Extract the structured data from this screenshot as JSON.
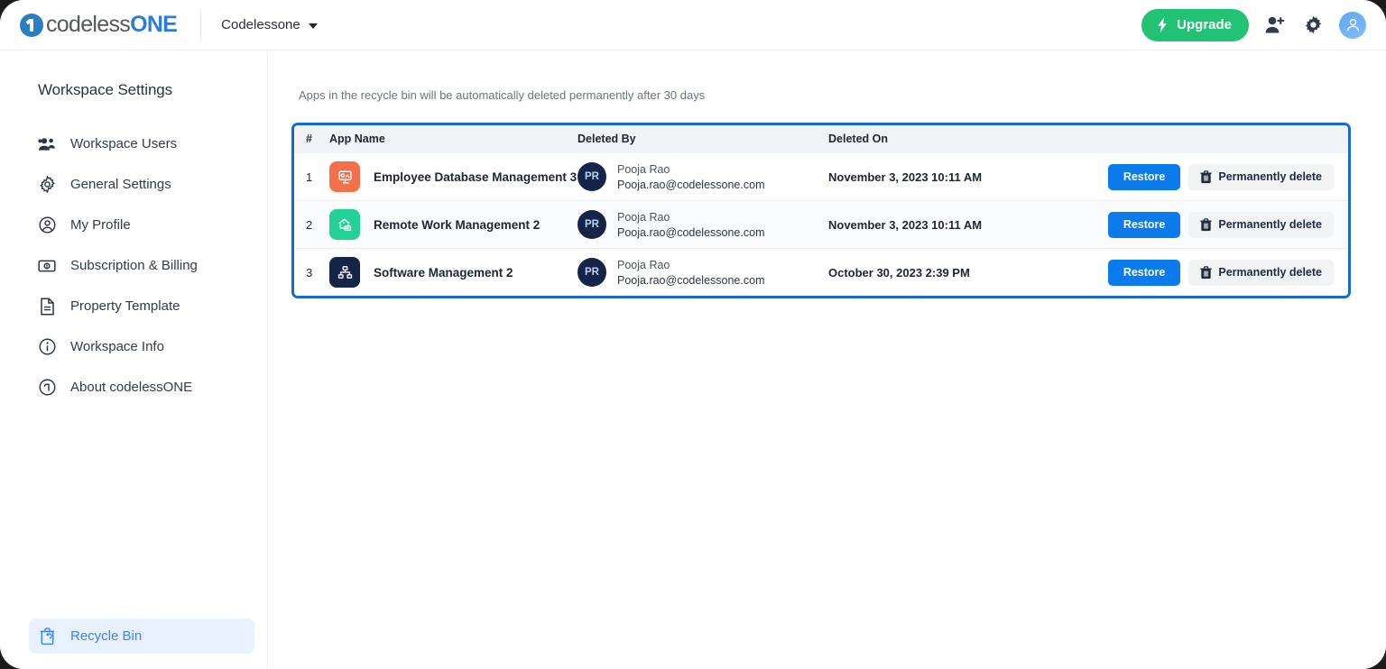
{
  "brand": {
    "logo_icon": "codeless-one-logo-icon",
    "name_part_1": "codeless",
    "name_part_2": "ONE",
    "color_primary": "#2b7ed6",
    "color_secondary": "#55585e"
  },
  "topbar": {
    "workspace_name": "Codelessone",
    "workspace_caret_icon": "chevron-down-icon",
    "upgrade_label": "Upgrade",
    "upgrade_icon": "lightning-bolt-icon",
    "upgrade_color": "#22c274",
    "invite_user_icon": "add-user-icon",
    "settings_icon": "gear-icon",
    "avatar_icon": "user-avatar-icon"
  },
  "sidebar": {
    "title": "Workspace Settings",
    "items": [
      {
        "label": "Workspace Users",
        "icon": "users-group-icon"
      },
      {
        "label": "General Settings",
        "icon": "gear-icon"
      },
      {
        "label": "My Profile",
        "icon": "user-circle-icon"
      },
      {
        "label": "Subscription & Billing",
        "icon": "banknote-icon"
      },
      {
        "label": "Property Template",
        "icon": "document-icon"
      },
      {
        "label": "Workspace Info",
        "icon": "info-circle-icon"
      },
      {
        "label": "About codelessONE",
        "icon": "copyright-circle-icon"
      }
    ],
    "footer_item": {
      "label": "Recycle Bin",
      "icon": "recycle-bin-icon",
      "active": true,
      "active_color": "#3b82f6",
      "active_background": "#e8f1fe"
    }
  },
  "main": {
    "notice": "Apps in the recycle bin will be automatically deleted permanently after 30 days",
    "table": {
      "border_color": "#1769d4",
      "columns": [
        "#",
        "App Name",
        "Deleted By",
        "Deleted On"
      ],
      "restore_label": "Restore",
      "restore_color": "#0b7bec",
      "permanently_delete_label": "Permanently delete",
      "permanently_delete_icon": "trash-icon",
      "rows": [
        {
          "index": "1",
          "app_name": "Employee Database Management 3",
          "app_icon": "monitor-presentation-icon",
          "app_icon_color": "#f4704a",
          "deleted_by_initials": "PR",
          "deleted_by_name": "Pooja Rao",
          "deleted_by_email": "Pooja.rao@codelessone.com",
          "deleted_on": "November 3, 2023 10:11 AM"
        },
        {
          "index": "2",
          "app_name": "Remote Work Management 2",
          "app_icon": "home-work-icon",
          "app_icon_color": "#23d196",
          "deleted_by_initials": "PR",
          "deleted_by_name": "Pooja Rao",
          "deleted_by_email": "Pooja.rao@codelessone.com",
          "deleted_on": "November 3, 2023 10:11 AM"
        },
        {
          "index": "3",
          "app_name": "Software Management 2",
          "app_icon": "sitemap-hierarchy-icon",
          "app_icon_color": "#152449",
          "deleted_by_initials": "PR",
          "deleted_by_name": "Pooja Rao",
          "deleted_by_email": "Pooja.rao@codelessone.com",
          "deleted_on": "October 30, 2023 2:39 PM"
        }
      ]
    }
  }
}
